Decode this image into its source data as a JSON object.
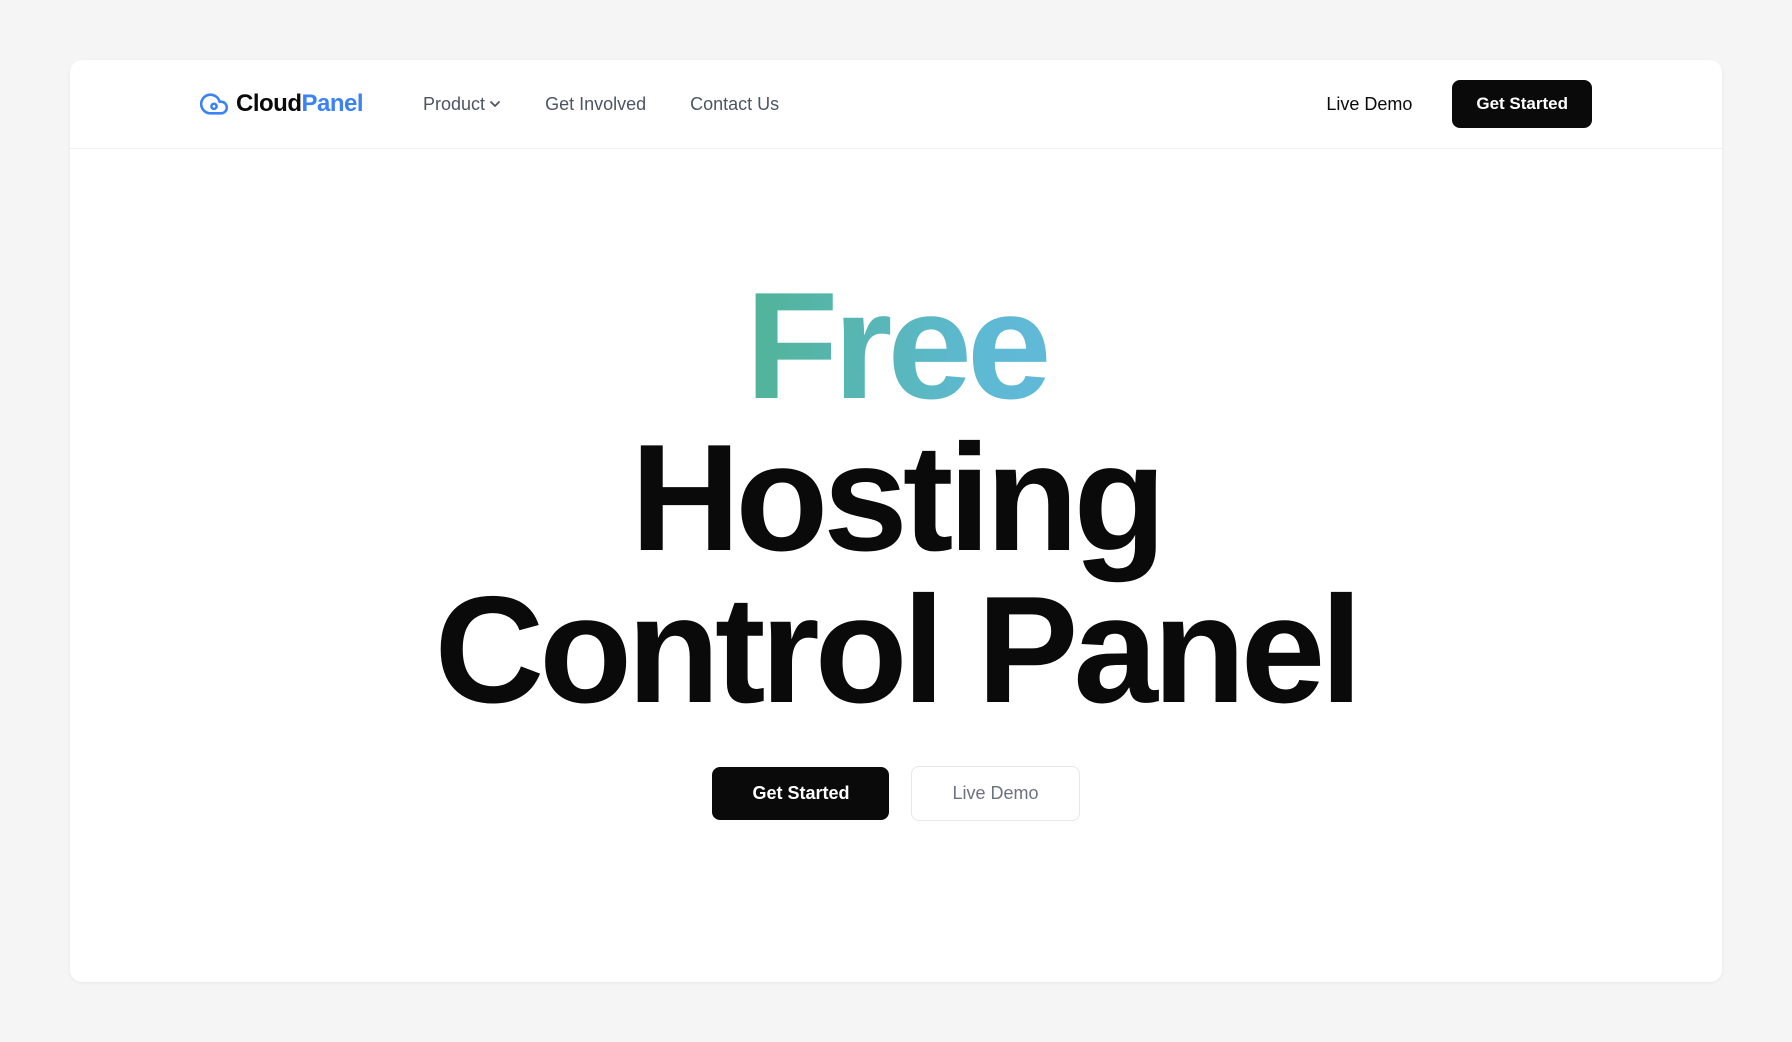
{
  "brand": {
    "name_part1": "Cloud",
    "name_part2": "Panel",
    "icon": "cloud-icon"
  },
  "nav": {
    "items": [
      {
        "label": "Product",
        "has_dropdown": true
      },
      {
        "label": "Get Involved",
        "has_dropdown": false
      },
      {
        "label": "Contact Us",
        "has_dropdown": false
      }
    ]
  },
  "header_actions": {
    "live_demo": "Live Demo",
    "get_started": "Get Started"
  },
  "hero": {
    "title_word_gradient": "Free",
    "title_line2": "Hosting",
    "title_line3": "Control Panel",
    "cta_primary": "Get Started",
    "cta_secondary": "Live Demo"
  },
  "colors": {
    "accent_blue": "#3b82f6",
    "text_dark": "#0a0a0a",
    "text_muted": "#4b5563",
    "gradient_start": "#3fa889",
    "gradient_end": "#6fb8e8"
  }
}
